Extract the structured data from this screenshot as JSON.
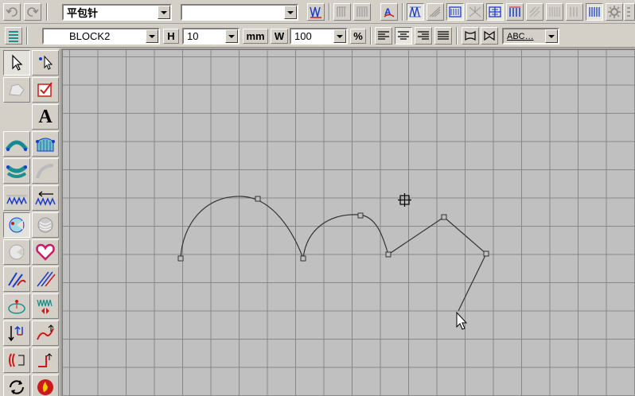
{
  "toolbar_top": {
    "stitch_type_value": "平包针",
    "second_combo_value": ""
  },
  "toolbar_text": {
    "font_value": "BLOCK2",
    "height_label": "H",
    "height_value": "10",
    "unit_label": "mm",
    "width_label": "W",
    "width_value": "100",
    "percent_label": "%",
    "text_sample": "ABC"
  },
  "left_tools": {
    "text_tool_label": "A"
  },
  "colors": {
    "window_bg": "#d4d0c8",
    "canvas_bg": "#c0c0c0",
    "grid_line": "#888888",
    "curve_line": "#333333",
    "accent_blue": "#1a3cc8",
    "accent_red": "#cc1a1a",
    "accent_teal": "#1a9090"
  }
}
